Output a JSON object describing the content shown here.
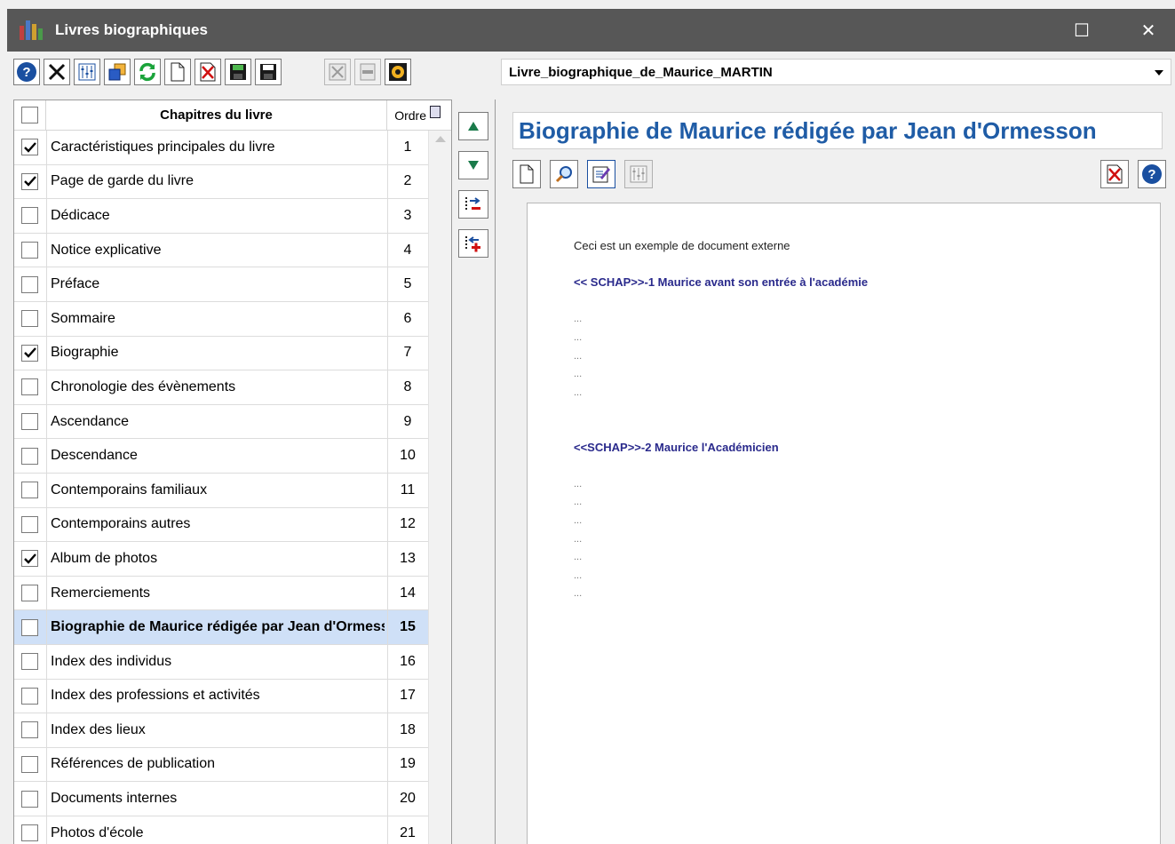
{
  "window": {
    "title": "Livres biographiques",
    "maximize_glyph": "☐",
    "close_glyph": "✕"
  },
  "toolbar": {
    "left_icons": [
      "help-icon",
      "tools-icon",
      "settings-grid-icon",
      "copy-icon",
      "refresh-icon",
      "new-document-icon",
      "delete-icon",
      "save-as-icon",
      "save-icon"
    ],
    "right_icons": [
      "cancel-icon",
      "minus-icon",
      "gear-icon"
    ]
  },
  "book_select": {
    "value": "Livre_biographique_de_Maurice_MARTIN"
  },
  "chapters": {
    "header_title": "Chapitres du livre",
    "header_order": "Ordre",
    "rows": [
      {
        "label": "Caractéristiques principales du livre",
        "order": "1",
        "checked": true
      },
      {
        "label": "Page de garde du livre",
        "order": "2",
        "checked": true
      },
      {
        "label": "Dédicace",
        "order": "3",
        "checked": false
      },
      {
        "label": "Notice explicative",
        "order": "4",
        "checked": false
      },
      {
        "label": "Préface",
        "order": "5",
        "checked": false
      },
      {
        "label": "Sommaire",
        "order": "6",
        "checked": false
      },
      {
        "label": "Biographie",
        "order": "7",
        "checked": true
      },
      {
        "label": "Chronologie des évènements",
        "order": "8",
        "checked": false
      },
      {
        "label": "Ascendance",
        "order": "9",
        "checked": false
      },
      {
        "label": "Descendance",
        "order": "10",
        "checked": false
      },
      {
        "label": "Contemporains familiaux",
        "order": "11",
        "checked": false
      },
      {
        "label": "Contemporains autres",
        "order": "12",
        "checked": false
      },
      {
        "label": "Album de photos",
        "order": "13",
        "checked": true
      },
      {
        "label": "Remerciements",
        "order": "14",
        "checked": false
      },
      {
        "label": "Biographie de Maurice rédigée par Jean d'Ormesson",
        "order": "15",
        "checked": false,
        "selected": true
      },
      {
        "label": "Index des individus",
        "order": "16",
        "checked": false
      },
      {
        "label": "Index des professions et activités",
        "order": "17",
        "checked": false
      },
      {
        "label": "Index des lieux",
        "order": "18",
        "checked": false
      },
      {
        "label": "Références de publication",
        "order": "19",
        "checked": false
      },
      {
        "label": "Documents internes",
        "order": "20",
        "checked": false
      },
      {
        "label": "Photos d'école",
        "order": "21",
        "checked": false
      }
    ]
  },
  "document": {
    "title": "Biographie de Maurice rédigée par Jean d'Ormesson",
    "intro": "Ceci est un exemple de document externe",
    "heading1": "<< SCHAP>>-1  Maurice avant son entrée à l'académie",
    "heading2": "<<SCHAP>>-2  Maurice l'Académicien",
    "dots": "..."
  },
  "colors": {
    "titlebar": "#575757",
    "selection": "#cfe0f7",
    "doc_title": "#1f5ca6",
    "doc_heading": "#2a2a8c"
  }
}
